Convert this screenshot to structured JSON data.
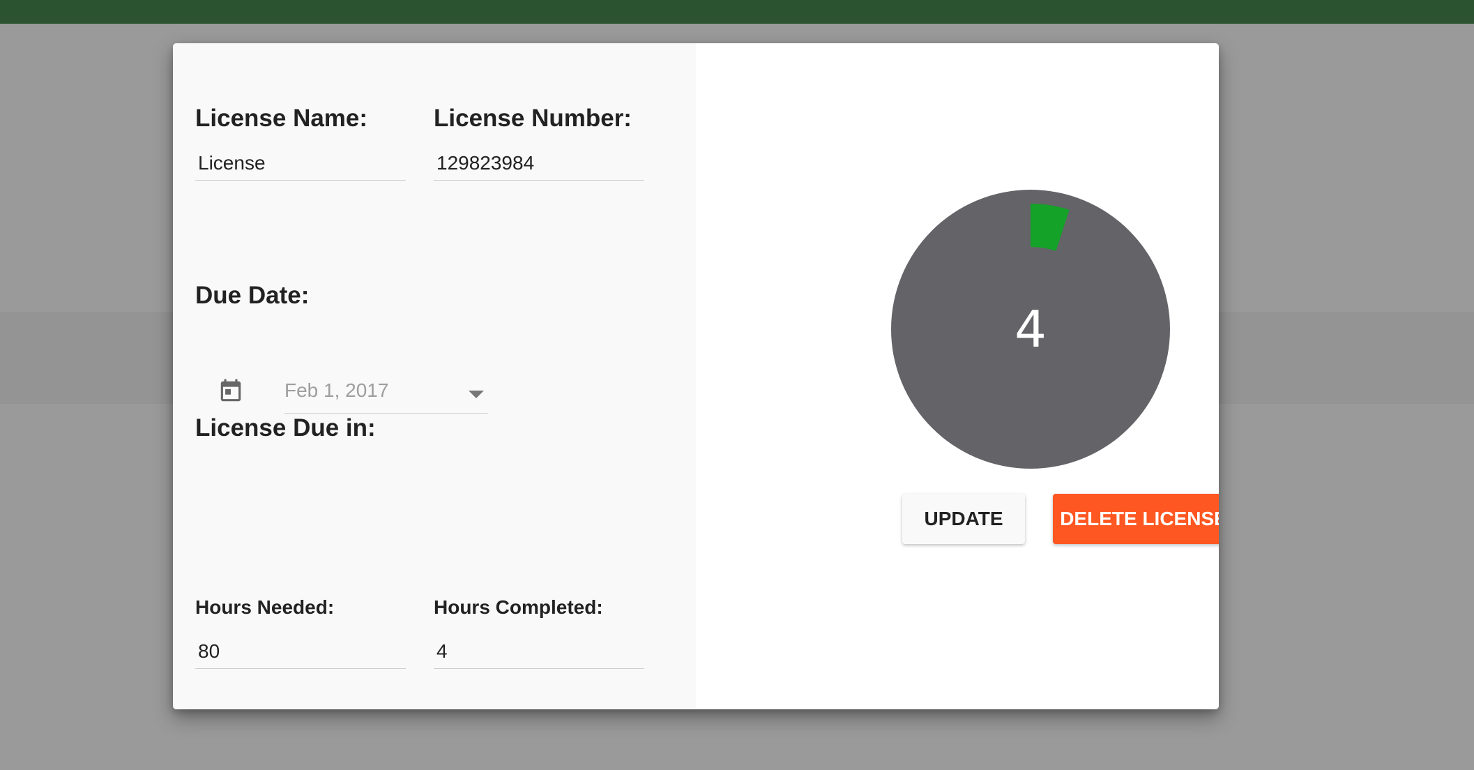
{
  "form": {
    "license_name_label": "License Name:",
    "license_name_value": "License",
    "license_number_label": "License Number:",
    "license_number_value": "129823984",
    "due_date_label": "Due Date:",
    "due_date_value": "Feb 1, 2017",
    "license_due_in_label": "License Due in:",
    "hours_needed_label": "Hours Needed:",
    "hours_needed_value": "80",
    "hours_completed_label": "Hours Completed:",
    "hours_completed_value": "4"
  },
  "progress_chart": {
    "center_label": "4",
    "completed_hours": 4,
    "needed_hours": 80,
    "remaining_color": "#636368",
    "completed_color": "#14a228"
  },
  "actions": {
    "update_label": "UPDATE",
    "delete_label": "DELETE LICENSE",
    "delete_color": "#ff5722"
  },
  "icons": {
    "calendar": "calendar-icon",
    "dropdown": "dropdown-arrow-icon"
  },
  "colors": {
    "topbar": "#2b5330",
    "overlay": "#9a9a9a"
  }
}
